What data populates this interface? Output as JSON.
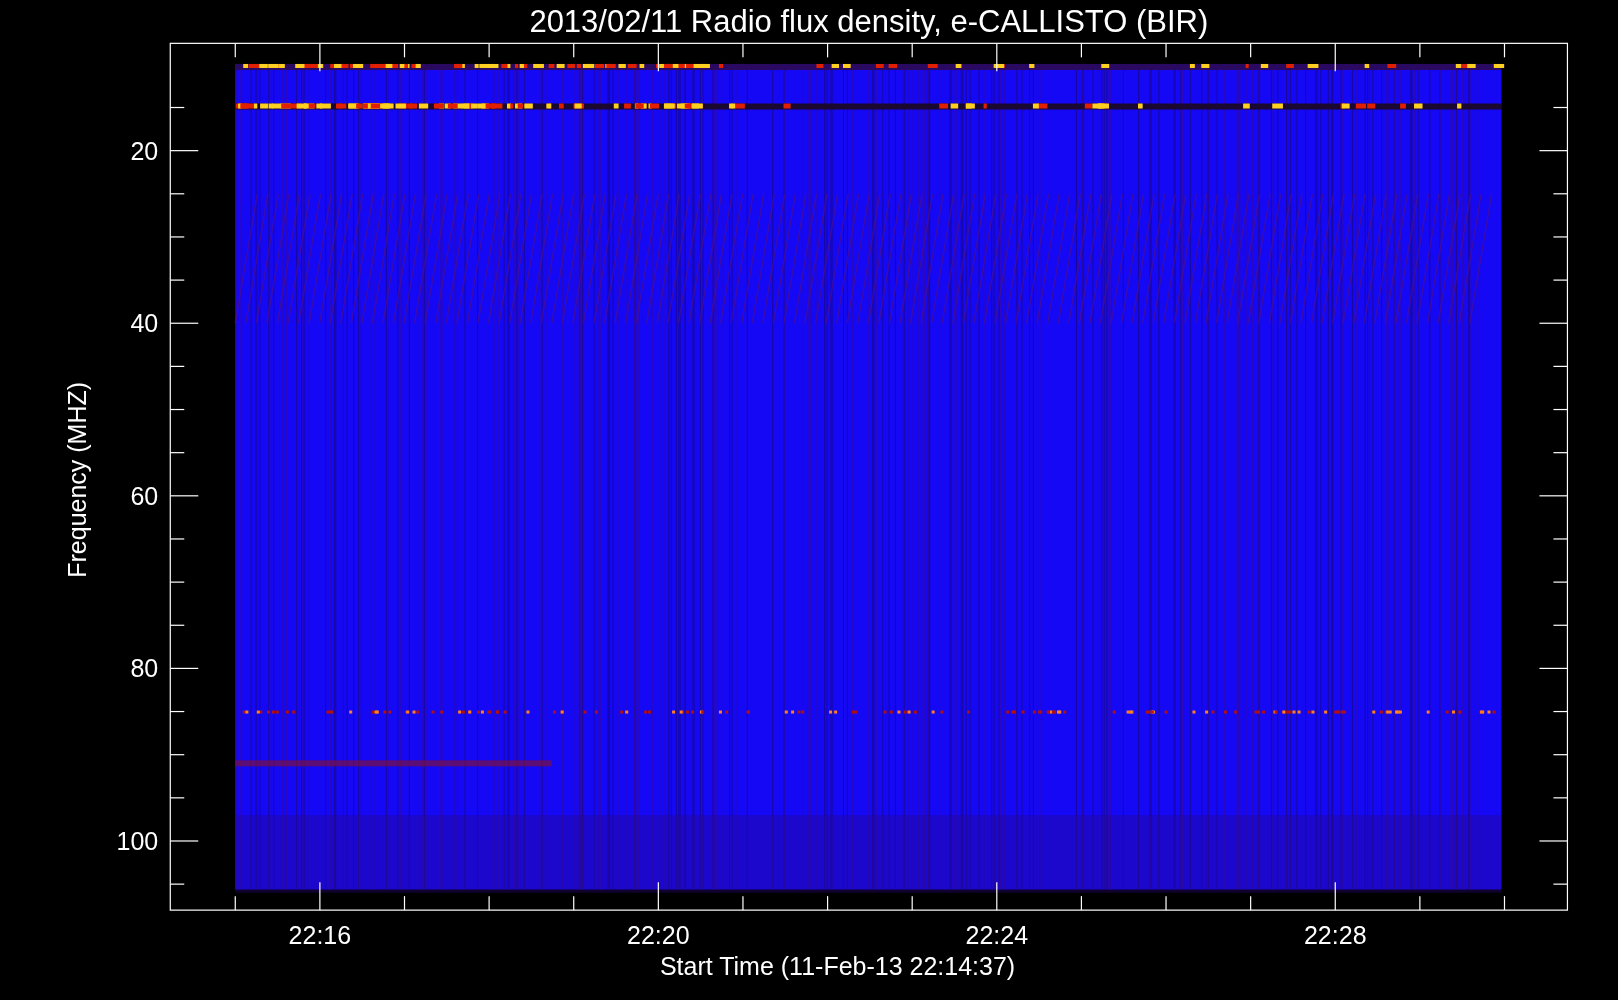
{
  "title": "2013/02/11  Radio flux density, e-CALLISTO (BIR)",
  "y_axis": {
    "label": "Frequency (MHZ)",
    "tick_labels": [
      "20",
      "40",
      "60",
      "80",
      "100"
    ]
  },
  "x_axis": {
    "label": "Start Time (11-Feb-13 22:14:37)",
    "tick_labels": [
      "22:16",
      "22:20",
      "22:24",
      "22:28"
    ]
  }
}
